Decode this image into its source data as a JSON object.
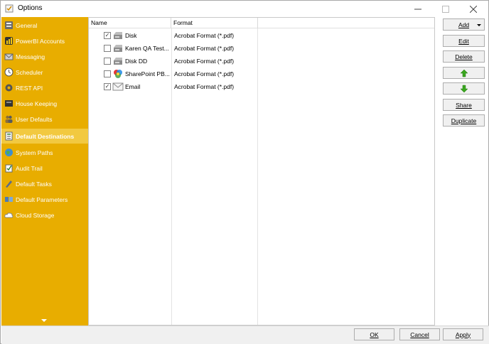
{
  "window": {
    "title": "Options"
  },
  "sidebar": {
    "items": [
      {
        "label": "General",
        "icon": "general-icon"
      },
      {
        "label": "PowerBI Accounts",
        "icon": "powerbi-icon"
      },
      {
        "label": "Messaging",
        "icon": "messaging-icon"
      },
      {
        "label": "Scheduler",
        "icon": "clock-icon"
      },
      {
        "label": "REST API",
        "icon": "api-icon"
      },
      {
        "label": "House Keeping",
        "icon": "house-keeping-icon"
      },
      {
        "label": "User Defaults",
        "icon": "users-icon"
      },
      {
        "label": "Default Destinations",
        "icon": "destinations-icon",
        "selected": true
      },
      {
        "label": "System Paths",
        "icon": "globe-icon"
      },
      {
        "label": "Audit Trail",
        "icon": "audit-icon"
      },
      {
        "label": "Default Tasks",
        "icon": "tasks-icon"
      },
      {
        "label": "Default Parameters",
        "icon": "parameters-icon"
      },
      {
        "label": "Cloud Storage",
        "icon": "cloud-icon"
      }
    ]
  },
  "list": {
    "columns": {
      "name": "Name",
      "format": "Format"
    },
    "rows": [
      {
        "checked": true,
        "name": "Disk",
        "format": "Acrobat Format (*.pdf)",
        "icon": "disk-icon"
      },
      {
        "checked": false,
        "name": "Karen QA Test...",
        "format": "Acrobat Format (*.pdf)",
        "icon": "disk-icon"
      },
      {
        "checked": false,
        "name": "Disk DD",
        "format": "Acrobat Format (*.pdf)",
        "icon": "disk-icon"
      },
      {
        "checked": false,
        "name": "SharePoint PB...",
        "format": "Acrobat Format (*.pdf)",
        "icon": "sharepoint-icon"
      },
      {
        "checked": true,
        "name": "Email",
        "format": "Acrobat Format (*.pdf)",
        "icon": "email-icon"
      }
    ],
    "check_mark": "✓"
  },
  "buttons": {
    "add": "Add",
    "edit": "Edit",
    "delete": "Delete",
    "share": "Share",
    "duplicate": "Duplicate"
  },
  "footer": {
    "ok": "OK",
    "cancel": "Cancel",
    "apply": "Apply"
  },
  "colors": {
    "sidebar": "#e8ad00",
    "sidebar_selected": "#f2c940",
    "arrow_green": "#3aa61f"
  }
}
